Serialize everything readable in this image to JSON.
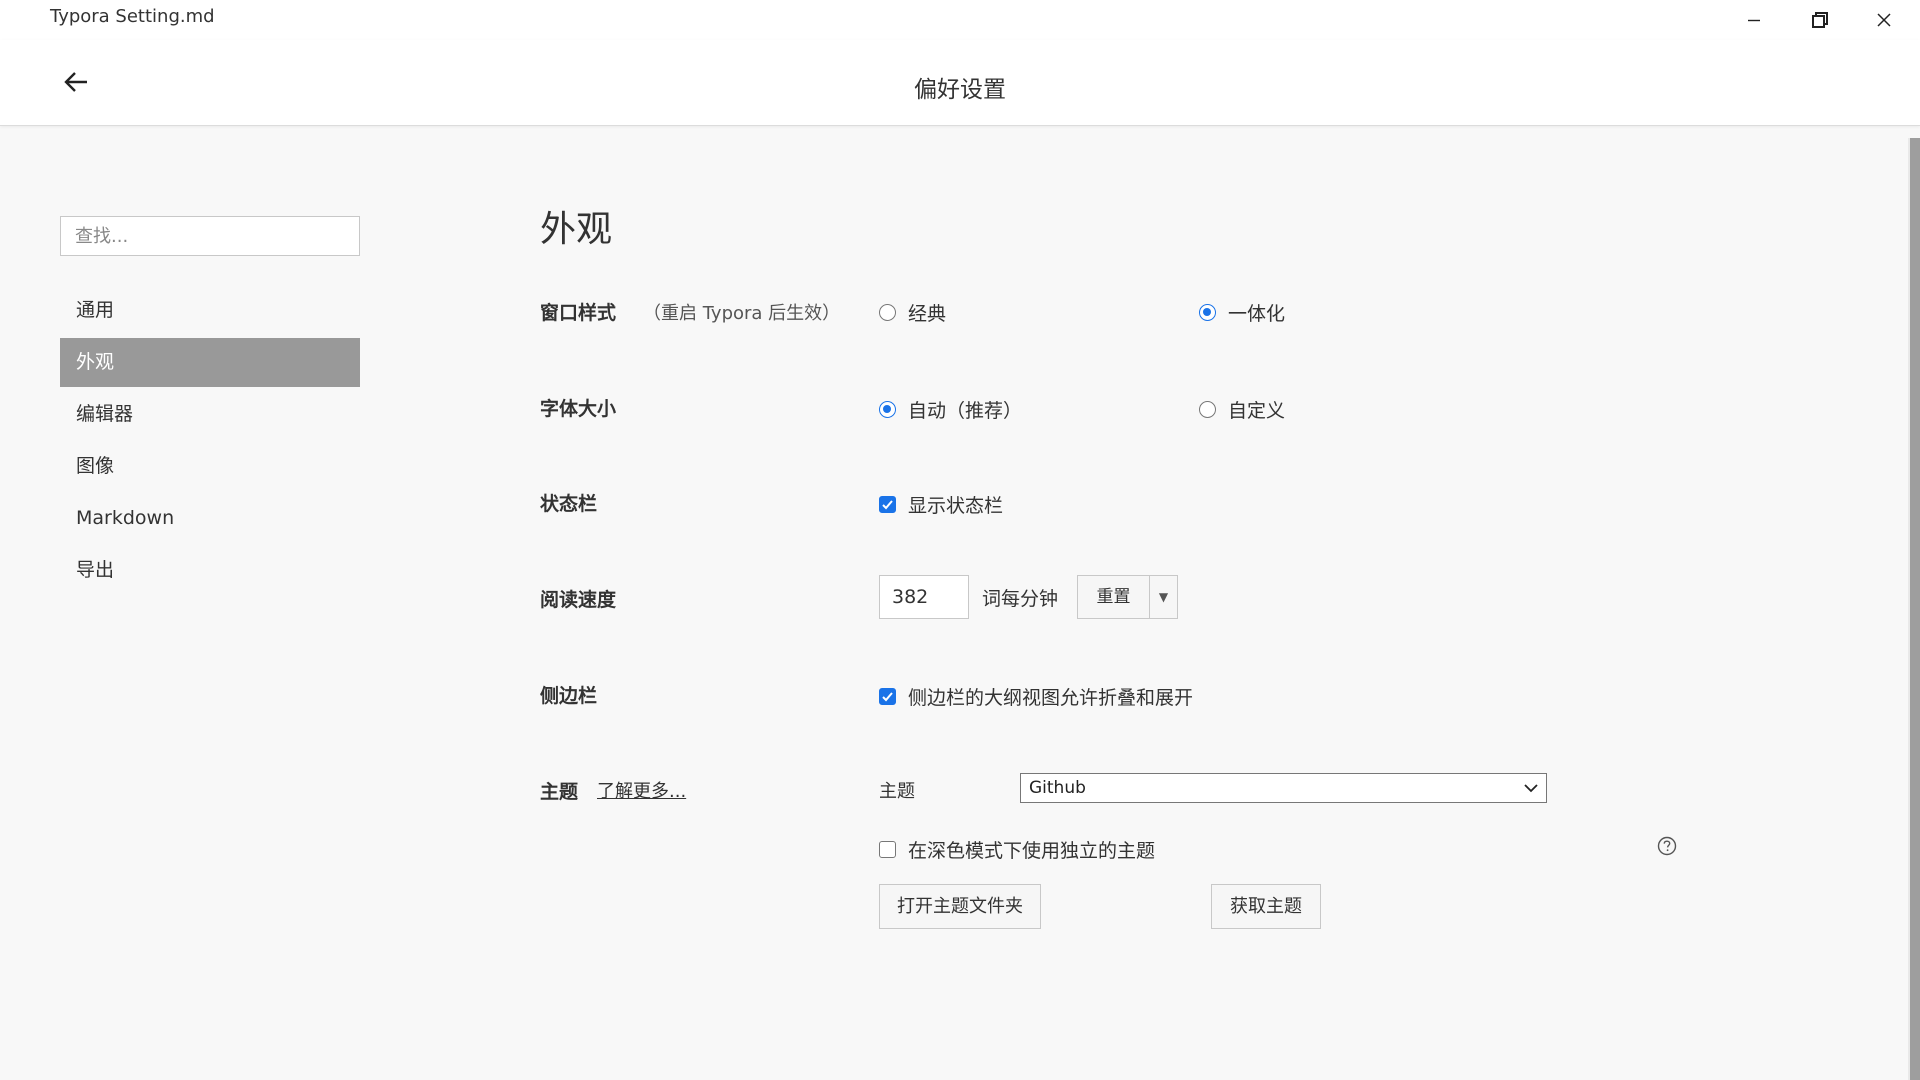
{
  "window": {
    "title": "Typora Setting.md",
    "controls": [
      "minimize-icon",
      "restore-icon",
      "close-icon"
    ]
  },
  "header": {
    "back_icon": "arrow-left-icon",
    "title": "偏好设置"
  },
  "sidebar": {
    "search_placeholder": "查找...",
    "items": [
      {
        "label": "通用"
      },
      {
        "label": "外观"
      },
      {
        "label": "编辑器"
      },
      {
        "label": "图像"
      },
      {
        "label": "Markdown"
      },
      {
        "label": "导出"
      }
    ],
    "active_index": 1
  },
  "main": {
    "section_title": "外观",
    "window_style": {
      "label": "窗口样式",
      "note": "（重启 Typora 后生效）",
      "options": [
        "经典",
        "一体化"
      ],
      "selected": "一体化"
    },
    "font_size": {
      "label": "字体大小",
      "options": [
        "自动（推荐）",
        "自定义"
      ],
      "selected": "自动（推荐）"
    },
    "status_bar": {
      "label": "状态栏",
      "checkbox_label": "显示状态栏",
      "checked": true
    },
    "reading_speed": {
      "label": "阅读速度",
      "value": "382",
      "unit": "词每分钟",
      "reset_label": "重置",
      "dropdown_glyph": "▼"
    },
    "sidebar_setting": {
      "label": "侧边栏",
      "checkbox_label": "侧边栏的大纲视图允许折叠和展开",
      "checked": true
    },
    "theme": {
      "label": "主题",
      "learn_more": "了解更多...",
      "select_label": "主题",
      "selected": "Github",
      "dark_mode_label": "在深色模式下使用独立的主题",
      "dark_mode_checked": false,
      "open_folder_label": "打开主题文件夹",
      "get_themes_label": "获取主题",
      "help_icon": "question-circle-icon"
    }
  },
  "colors": {
    "accent": "#1a73e8",
    "active_nav_bg": "#999999",
    "page_bg": "#f8f8f8",
    "header_bg": "#ffffff"
  }
}
